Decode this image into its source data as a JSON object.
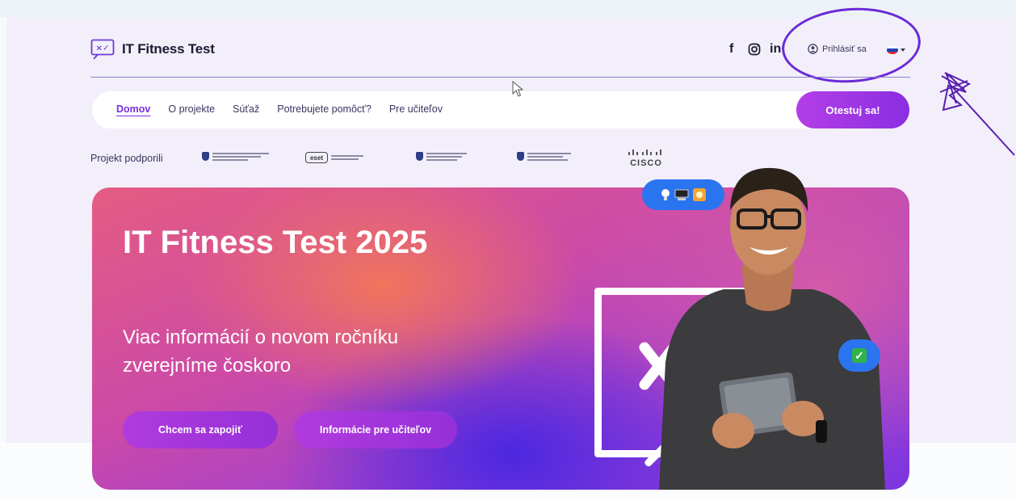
{
  "header": {
    "logo_glyph": "×✓",
    "logo_text": "IT Fitness Test",
    "social": [
      "f",
      "in"
    ],
    "login_label": "Prihlásiť sa",
    "language": "sk"
  },
  "nav": {
    "items": [
      {
        "label": "Domov",
        "active": true
      },
      {
        "label": "O projekte",
        "active": false
      },
      {
        "label": "Súťaž",
        "active": false
      },
      {
        "label": "Potrebujete pomôcť?",
        "active": false
      },
      {
        "label": "Pre učiteľov",
        "active": false
      }
    ],
    "cta_label": "Otestuj sa!"
  },
  "sponsors": {
    "label": "Projekt podporili",
    "eset_text": "eset",
    "cisco_text": "CISCO"
  },
  "hero": {
    "title": "IT Fitness Test 2025",
    "subtitle": "Viac informácií o novom ročníku zverejníme čoskoro",
    "primary_button": "Chcem sa zapojiť",
    "secondary_button": "Informácie pre učiteľov",
    "check_mark": "✓"
  },
  "colors": {
    "accent": "#8a2ee2",
    "nav_active": "#7b2fe0",
    "badge_blue": "#2b74ef",
    "annotation": "#6a2ad8"
  },
  "icons": {
    "facebook": "facebook-icon",
    "instagram": "instagram-icon",
    "linkedin": "linkedin-icon",
    "user": "user-circle-icon",
    "flag": "slovak-flag-icon",
    "dropdown": "chevron-down-icon"
  }
}
